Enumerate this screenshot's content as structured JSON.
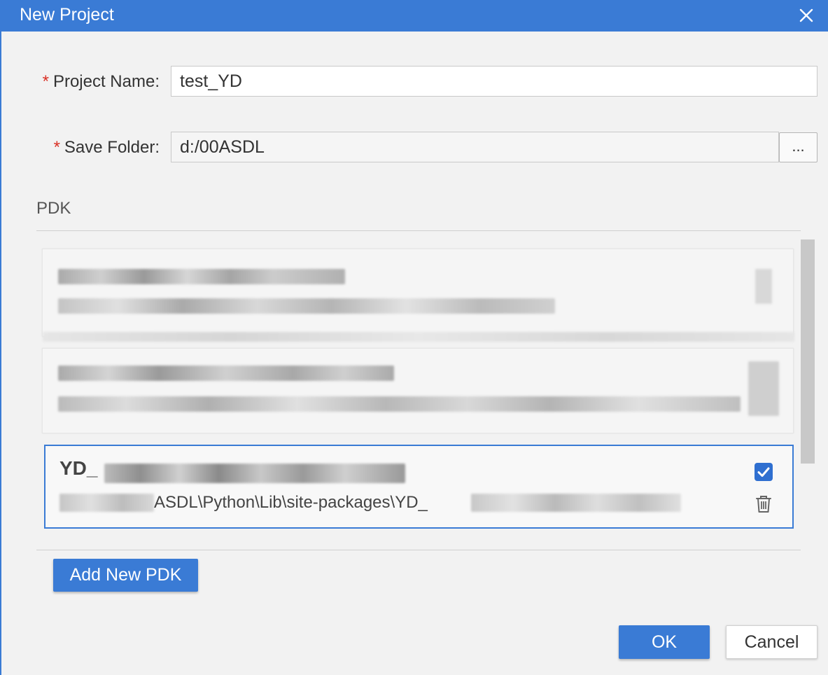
{
  "dialog": {
    "title": "New Project",
    "close_icon": "close-icon"
  },
  "form": {
    "project_name_label": "Project Name:",
    "project_name_value": "test_YD",
    "save_folder_label": "Save Folder:",
    "save_folder_value": "d:/00ASDL",
    "browse_label": "...",
    "required_marker": "*"
  },
  "pdk": {
    "section_title": "PDK",
    "selected_item": {
      "name": "YD_",
      "path": "ASDL\\Python\\Lib\\site-packages\\YD_",
      "checked": true,
      "check_icon": "checkbox-checked-icon",
      "delete_icon": "trash-icon"
    },
    "add_button_label": "Add New PDK"
  },
  "footer": {
    "ok_label": "OK",
    "cancel_label": "Cancel"
  },
  "colors": {
    "accent": "#3a7bd5",
    "required": "#d93025",
    "background": "#f2f2f2"
  }
}
